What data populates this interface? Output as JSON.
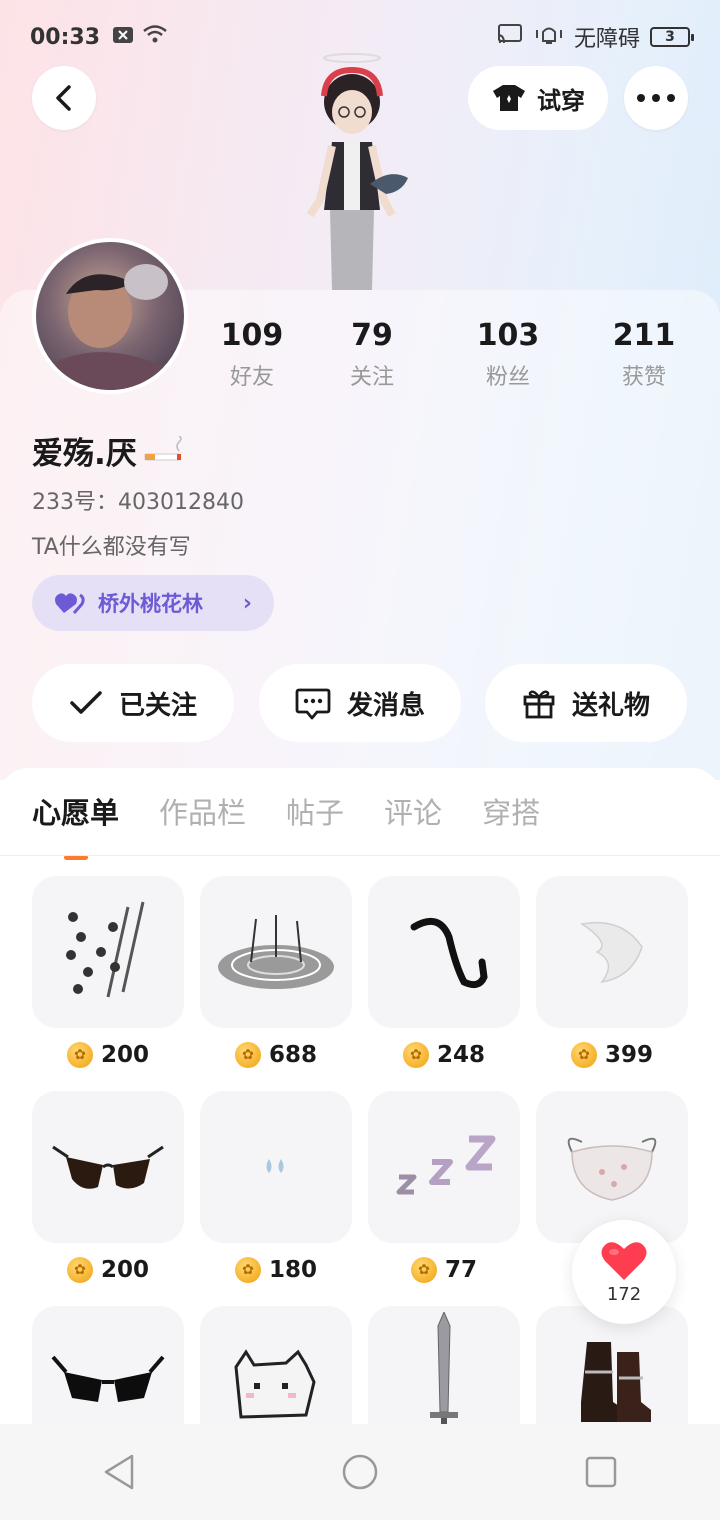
{
  "status_bar": {
    "time": "00:33",
    "accessibility_label": "无障碍",
    "battery": "3"
  },
  "header": {
    "tryon_label": "试穿"
  },
  "profile": {
    "stats": [
      {
        "value": "109",
        "label": "好友"
      },
      {
        "value": "79",
        "label": "关注"
      },
      {
        "value": "103",
        "label": "粉丝"
      },
      {
        "value": "211",
        "label": "获赞"
      }
    ],
    "nickname": "爱殇.厌",
    "uid": "233号：403012840",
    "bio": "TA什么都没有写",
    "group_chip": "桥外桃花林"
  },
  "actions": {
    "follow_label": "已关注",
    "message_label": "发消息",
    "gift_label": "送礼物"
  },
  "tabs": [
    "心愿单",
    "作品栏",
    "帖子",
    "评论",
    "穿搭"
  ],
  "wishlist": [
    {
      "icon": "claw-sticks",
      "price": "200"
    },
    {
      "icon": "magic-circle",
      "price": "688"
    },
    {
      "icon": "black-tail",
      "price": "248"
    },
    {
      "icon": "white-wing",
      "price": "399"
    },
    {
      "icon": "sunglasses",
      "price": "200"
    },
    {
      "icon": "teardrops",
      "price": "180"
    },
    {
      "icon": "zzz",
      "price": "77"
    },
    {
      "icon": "face-mask",
      "price": ""
    },
    {
      "icon": "black-glasses",
      "price": ""
    },
    {
      "icon": "pixel-cat",
      "price": ""
    },
    {
      "icon": "sword",
      "price": ""
    },
    {
      "icon": "boots",
      "price": ""
    }
  ],
  "like_float": {
    "count": "172"
  },
  "colors": {
    "accent_orange": "#ff7a2a",
    "chip_bg": "#e6e0f7",
    "chip_text": "#6c5bd4",
    "heart": "#ff3d50"
  }
}
